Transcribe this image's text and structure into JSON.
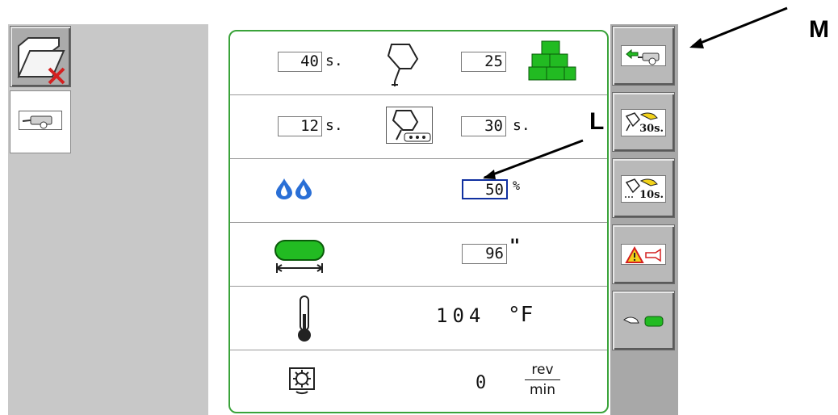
{
  "left_strip": {
    "folder_softkey_icon": "folder-delete-icon",
    "implement_tile_icon": "baler-icon"
  },
  "rows": [
    {
      "left_value": "40",
      "left_unit": "s.",
      "icon": "knotter-icon",
      "right_value": "25",
      "right_icon": "bale-stack-icon"
    },
    {
      "left_value": "12",
      "left_unit": "s.",
      "icon": "knotter-chain-icon",
      "right_value": "30",
      "right_unit": "s."
    },
    {
      "icon": "moisture-drops-icon",
      "value": "50",
      "unit": "%"
    },
    {
      "icon": "bale-length-icon",
      "value": "96",
      "unit": "\""
    },
    {
      "icon": "thermometer-icon",
      "value": "104",
      "unit": "°F"
    },
    {
      "icon": "gearbox-rotation-icon",
      "value": "0",
      "unit_top": "rev",
      "unit_bottom": "min"
    }
  ],
  "softkeys": [
    {
      "name": "return-to-baler-softkey",
      "icon": "back-arrow-baler-icon"
    },
    {
      "name": "knotter-30s-softkey",
      "label": "30s."
    },
    {
      "name": "knotter-chain-10s-softkey",
      "label": "10s."
    },
    {
      "name": "alarm-horn-softkey",
      "icon": "warning-horn-icon"
    },
    {
      "name": "manual-bale-softkey",
      "icon": "hand-bale-icon"
    }
  ],
  "callouts": {
    "L": "L",
    "M": "M"
  },
  "colors": {
    "panel_border": "#3aa33a",
    "green_fill": "#22bb22",
    "drop_blue": "#2a6fd6",
    "focus_blue": "#1030a0",
    "warning_yellow": "#f2d21a"
  }
}
